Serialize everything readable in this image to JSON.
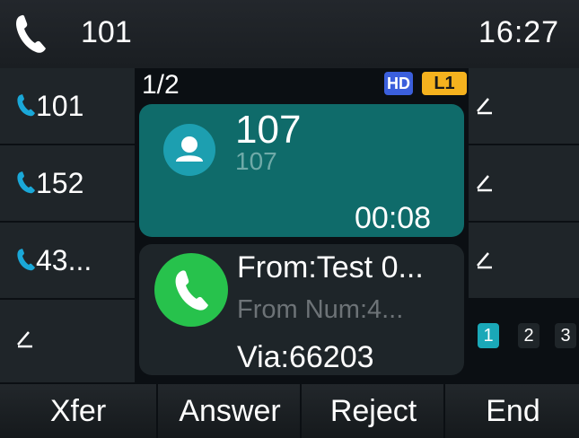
{
  "status": {
    "line": "101",
    "time": "16:27"
  },
  "line_keys": [
    {
      "label": "101",
      "icon": "phone-icon"
    },
    {
      "label": "152",
      "icon": "phone-icon"
    },
    {
      "label": "43...",
      "icon": "phone-icon"
    },
    {
      "label": "",
      "icon": "pencil-icon"
    }
  ],
  "call": {
    "counter": "1/2",
    "hd_badge": "HD",
    "line_badge": "L1",
    "active": {
      "name": "107",
      "number": "107",
      "duration": "00:08"
    },
    "incoming": {
      "from": "From:Test 0...",
      "from_num": "From Num:4...",
      "via": "Via:66203"
    }
  },
  "pages": [
    "1",
    "2",
    "3"
  ],
  "softkeys": [
    "Xfer",
    "Answer",
    "Reject",
    "End"
  ],
  "colors": {
    "accent_teal": "#0f6b6a",
    "phone_icon_blue": "#1aa8d8",
    "answer_green": "#27c24c",
    "hd_blue": "#3b5fdc",
    "line_yellow": "#f5b21e"
  }
}
